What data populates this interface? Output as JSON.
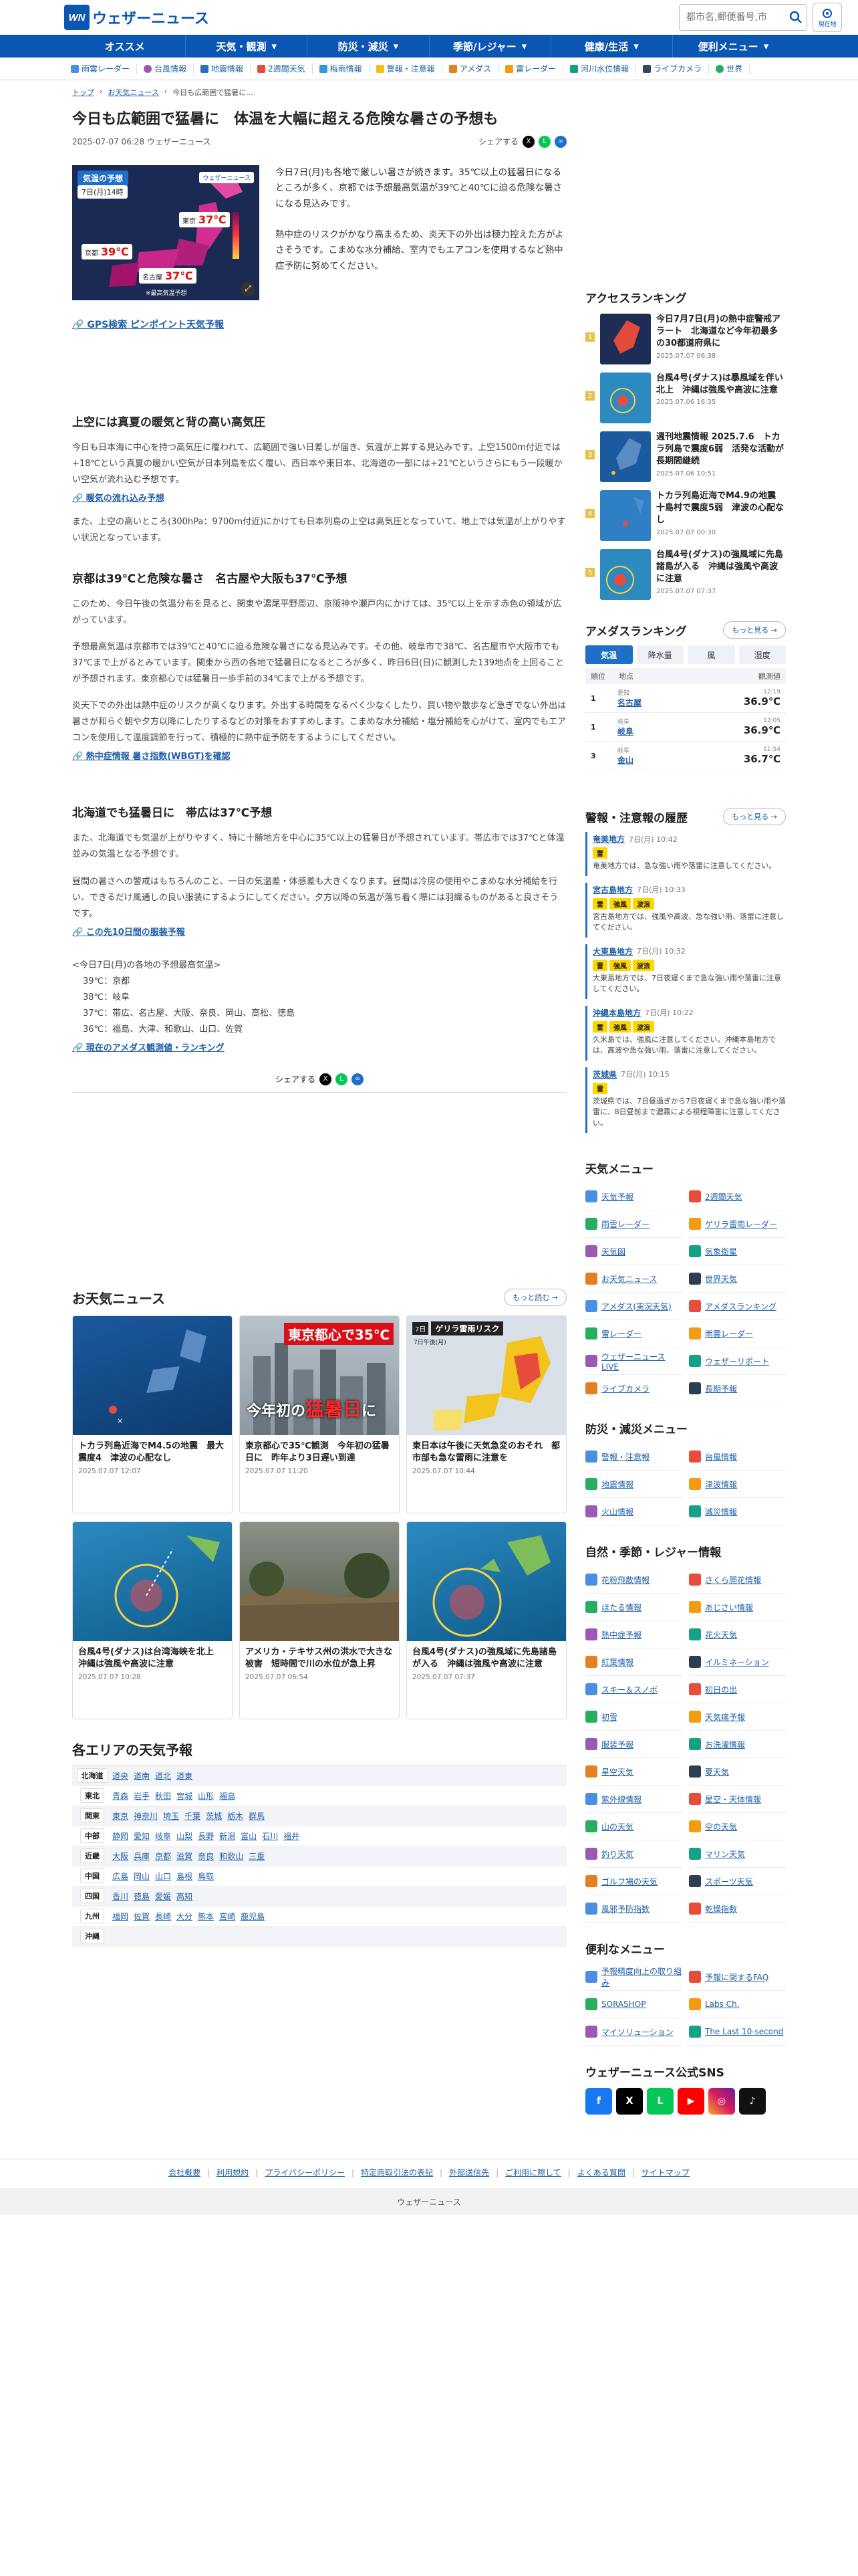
{
  "header": {
    "logo_mark": "WN",
    "logo_text": "ウェザーニュース",
    "search_placeholder": "都市名,郵便番号,市",
    "loc_label": "現在地"
  },
  "gnav": [
    "オススメ",
    "天気・観測",
    "防災・減災",
    "季節/レジャー",
    "健康/生活",
    "便利メニュー"
  ],
  "snav": [
    "雨雲レーダー",
    "台風情報",
    "地震情報",
    "2週間天気",
    "梅雨情報",
    "警報・注意報",
    "アメダス",
    "雷レーダー",
    "河川水位情報",
    "ライブカメラ",
    "世界"
  ],
  "crumb": [
    "トップ",
    "お天気ニュース",
    "今日も広範囲で猛暑に..."
  ],
  "article": {
    "title": "今日も広範囲で猛暑に　体温を大幅に超える危険な暑さの予想も",
    "date": "2025-07-07 06:28 ウェザーニュース",
    "share": "シェアする",
    "img": {
      "badge": "気温の予想",
      "day": "7日(月)14時",
      "city1": "東京",
      "t1": "37℃",
      "city2": "京都",
      "t2": "39℃",
      "city3": "名古屋",
      "t3": "37℃",
      "mark": "ウェザーニュース",
      "note": "※最高気温予想"
    },
    "lead1": "今日7日(月)も各地で厳しい暑さが続きます。35℃以上の猛暑日になるところが多く、京都では予想最高気温が39℃と40℃に迫る危険な暑さになる見込みです。",
    "lead2": "熱中症のリスクがかなり高まるため、炎天下の外出は極力控えた方がよさそうです。こまめな水分補給、室内でもエアコンを使用するなど熱中症予防に努めてください。",
    "gps": "GPS検索 ピンポイント天気予報",
    "h_1": "上空には真夏の暖気と背の高い高気圧",
    "p_1a": "今日も日本海に中心を持つ高気圧に覆われて、広範囲で強い日差しが届き、気温が上昇する見込みです。上空1500m付近では+18℃という真夏の暖かい空気が日本列島を広く覆い、西日本や東日本、北海道の一部には+21℃というさらにもう一段暖かい空気が流れ込む予想です。",
    "l_1": "暖気の流れ込み予想",
    "p_1b": "また、上空の高いところ(300hPa：9700m付近)にかけても日本列島の上空は高気圧となっていて、地上では気温が上がりやすい状況となっています。",
    "h_2": "京都は39℃と危険な暑さ　名古屋や大阪も37℃予想",
    "p_2a": "このため、今日午後の気温分布を見ると、関東や濃尾平野周辺、京阪神や瀬戸内にかけては、35℃以上を示す赤色の領域が広がっています。",
    "p_2b": "予想最高気温は京都市では39℃と40℃に迫る危険な暑さになる見込みです。その他、岐阜市で38℃、名古屋市や大阪市でも37℃まで上がるとみています。関東から西の各地で猛暑日になるところが多く、昨日6日(日)に観測した139地点を上回ることが予想されます。東京都心では猛暑日一歩手前の34℃まで上がる予想です。",
    "p_2c": "炎天下での外出は熱中症のリスクが高くなります。外出する時間をなるべく少なくしたり、買い物や散歩など急ぎでない外出は暑さが和らぐ朝や夕方以降にしたりするなどの対策をおすすめします。こまめな水分補給・塩分補給を心がけて、室内でもエアコンを使用して温度調節を行って、積極的に熱中症予防をするようにしてください。",
    "l_2": "熱中症情報 暑さ指数(WBGT)を確認",
    "h_3": "北海道でも猛暑日に　帯広は37℃予想",
    "p_3a": "また、北海道でも気温が上がりやすく、特に十勝地方を中心に35℃以上の猛暑日が予想されています。帯広市では37℃と体温並みの気温となる予想です。",
    "p_3b": "昼間の暑さへの警戒はもちろんのこと、一日の気温差・体感差も大きくなります。昼間は冷房の使用やこまめな水分補給を行い、できるだけ風通しの良い服装にするようにしてください。夕方以降の気温が落ち着く際には羽織るものがあると良さそうです。",
    "l_3": "この先10日間の服装予報",
    "list_title": "<今日7日(月)の各地の予想最高気温>",
    "list": [
      "39℃：京都",
      "38℃：岐阜",
      "37℃：帯広、名古屋、大阪、奈良、岡山、高松、徳島",
      "36℃：福島、大津、和歌山、山口、佐賀"
    ],
    "l_4": "現在のアメダス観測値・ランキング"
  },
  "news": {
    "title": "お天気ニュース",
    "more": "もっと読む",
    "items": [
      {
        "t": "トカラ列島近海でM4.5の地震　最大震度4　津波の心配なし",
        "d": "2025.07.07 12:07"
      },
      {
        "t": "東京都心で35℃観測　今年初の猛暑日に　昨年より3日遅い到達",
        "d": "2025.07.07 11:20",
        "o1": "東京都心で35℃",
        "o2": "今年初の",
        "o3": "猛暑日",
        "o4": "に"
      },
      {
        "t": "東日本は午後に天気急変のおそれ　都市部も急な雷雨に注意を",
        "d": "2025.07.07 10:44",
        "o1": "7日",
        "o2": "ゲリラ雷雨リスク",
        "o3": "7日午後(月)"
      },
      {
        "t": "台風4号(ダナス)は台湾海峡を北上　沖縄は強風や高波に注意",
        "d": "2025.07.07 10:28"
      },
      {
        "t": "アメリカ・テキサス州の洪水で大きな被害　短時間で川の水位が急上昇",
        "d": "2025.07.07 06:54"
      },
      {
        "t": "台風4号(ダナス)の強風域に先島諸島が入る　沖縄は強風や高波に注意",
        "d": "2025.07.07 07:37"
      }
    ]
  },
  "areas": {
    "title": "各エリアの天気予報",
    "rows": [
      {
        "n": "北海道",
        "l": [
          "道央",
          "道南",
          "道北",
          "道東"
        ]
      },
      {
        "n": "東北",
        "l": [
          "青森",
          "岩手",
          "秋田",
          "宮城",
          "山形",
          "福島"
        ]
      },
      {
        "n": "関東",
        "l": [
          "東京",
          "神奈川",
          "埼玉",
          "千葉",
          "茨城",
          "栃木",
          "群馬"
        ]
      },
      {
        "n": "中部",
        "l": [
          "静岡",
          "愛知",
          "岐阜",
          "山梨",
          "長野",
          "新潟",
          "富山",
          "石川",
          "福井"
        ]
      },
      {
        "n": "近畿",
        "l": [
          "大阪",
          "兵庫",
          "京都",
          "滋賀",
          "奈良",
          "和歌山",
          "三重"
        ]
      },
      {
        "n": "中国",
        "l": [
          "広島",
          "岡山",
          "山口",
          "島根",
          "鳥取"
        ]
      },
      {
        "n": "四国",
        "l": [
          "香川",
          "徳島",
          "愛媛",
          "高知"
        ]
      },
      {
        "n": "九州",
        "l": [
          "福岡",
          "佐賀",
          "長崎",
          "大分",
          "熊本",
          "宮崎",
          "鹿児島"
        ]
      },
      {
        "n": "沖縄",
        "l": []
      }
    ]
  },
  "footer": {
    "links": [
      "会社概要",
      "利用規約",
      "プライバシーポリシー",
      "特定商取引法の表記",
      "外部送信先",
      "ご利用に際して",
      "よくある質問",
      "サイトマップ"
    ],
    "copy": "ウェザーニュース"
  },
  "side": {
    "access_title": "アクセスランキング",
    "access": [
      {
        "t": "今日7月7日(月)の熱中症警戒アラート　北海道など今年初最多の30都道府県に",
        "d": "2025.07.07 06:38"
      },
      {
        "t": "台風4号(ダナス)は暴風域を伴い北上　沖縄は強風や高波に注意",
        "d": "2025.07.06 16:35"
      },
      {
        "t": "週刊地震情報 2025.7.6　トカラ列島で震度6弱　活発な活動が長期間継続",
        "d": "2025.07.06 10:51"
      },
      {
        "t": "トカラ列島近海でM4.9の地震　十島村で震度5弱　津波の心配なし",
        "d": "2025.07.07 00:30"
      },
      {
        "t": "台風4号(ダナス)の強風域に先島諸島が入る　沖縄は強風や高波に注意",
        "d": "2025.07.07 07:37"
      }
    ],
    "amedas_title": "アメダスランキング",
    "amedas_more": "もっと見る",
    "amedas_tabs": [
      "気温",
      "降水量",
      "風",
      "湿度"
    ],
    "amedas_head": [
      "順位",
      "地点",
      "観測値"
    ],
    "amedas": [
      {
        "n": "1",
        "pref": "愛知",
        "pl": "名古屋",
        "t": "12:19",
        "v": "36.9℃"
      },
      {
        "n": "1",
        "pref": "岐阜",
        "pl": "岐阜",
        "t": "12:05",
        "v": "36.9℃"
      },
      {
        "n": "3",
        "pref": "岐阜",
        "pl": "金山",
        "t": "11:54",
        "v": "36.7℃"
      }
    ],
    "warn_title": "警報・注意報の履歴",
    "warn_more": "もっと見る",
    "warns": [
      {
        "p": "奄美地方",
        "d": "7日(月) 10:42",
        "b": [
          "雷"
        ],
        "t": "奄美地方では、急な強い雨や落雷に注意してください。"
      },
      {
        "p": "宮古島地方",
        "d": "7日(月) 10:33",
        "b": [
          "雷",
          "強風",
          "波浪"
        ],
        "t": "宮古島地方では、強風や高波、急な強い雨、落雷に注意してください。"
      },
      {
        "p": "大東島地方",
        "d": "7日(月) 10:32",
        "b": [
          "雷",
          "強風",
          "波浪"
        ],
        "t": "大東島地方では、7日夜遅くまで急な強い雨や落雷に注意してください。"
      },
      {
        "p": "沖縄本島地方",
        "d": "7日(月) 10:22",
        "b": [
          "雷",
          "強風",
          "波浪"
        ],
        "t": "久米島では、強風に注意してください。沖縄本島地方では、高波や急な強い雨、落雷に注意してください。"
      },
      {
        "p": "茨城県",
        "d": "7日(月) 10:15",
        "b": [
          "雷"
        ],
        "t": "茨城県では、7日昼過ぎから7日夜遅くまで急な強い雨や落雷に、8日昼前まで濃霧による視程障害に注意してください。"
      }
    ],
    "menu1_title": "天気メニュー",
    "menu1": [
      "天気予報",
      "2週間天気",
      "雨雲レーダー",
      "ゲリラ雷雨レーダー",
      "天気図",
      "気象衛星",
      "お天気ニュース",
      "世界天気",
      "アメダス(実況天気)",
      "アメダスランキング",
      "雷レーダー",
      "雨雲レーダー",
      "ウェザーニュースLIVE",
      "ウェザーリポート",
      "ライブカメラ",
      "長期予報"
    ],
    "menu2_title": "防災・減災メニュー",
    "menu2": [
      "警報・注意報",
      "台風情報",
      "地震情報",
      "津波情報",
      "火山情報",
      "減災情報"
    ],
    "menu3_title": "自然・季節・レジャー情報",
    "menu3": [
      "花粉飛散情報",
      "さくら開花情報",
      "ほたる情報",
      "あじさい情報",
      "熱中症予報",
      "花火天気",
      "紅葉情報",
      "イルミネーション",
      "スキー＆スノボ",
      "初日の出",
      "初雪",
      "天気痛予報",
      "服装予報",
      "お洗濯情報",
      "星空天気",
      "夏天気",
      "紫外線情報",
      "星空・天体情報",
      "山の天気",
      "空の天気",
      "釣り天気",
      "マリン天気",
      "ゴルフ場の天気",
      "スポーツ天気",
      "風邪予防指数",
      "乾燥指数"
    ],
    "menu4_title": "便利なメニュー",
    "menu4": [
      "予報精度向上の取り組み",
      "予報に関するFAQ",
      "SORASHOP",
      "Labs Ch.",
      "マイソリューション",
      "The Last 10-second"
    ],
    "sns_title": "ウェザーニュース公式SNS",
    "sns": [
      "f",
      "X",
      "L",
      "▶",
      "◎",
      "♪"
    ]
  }
}
